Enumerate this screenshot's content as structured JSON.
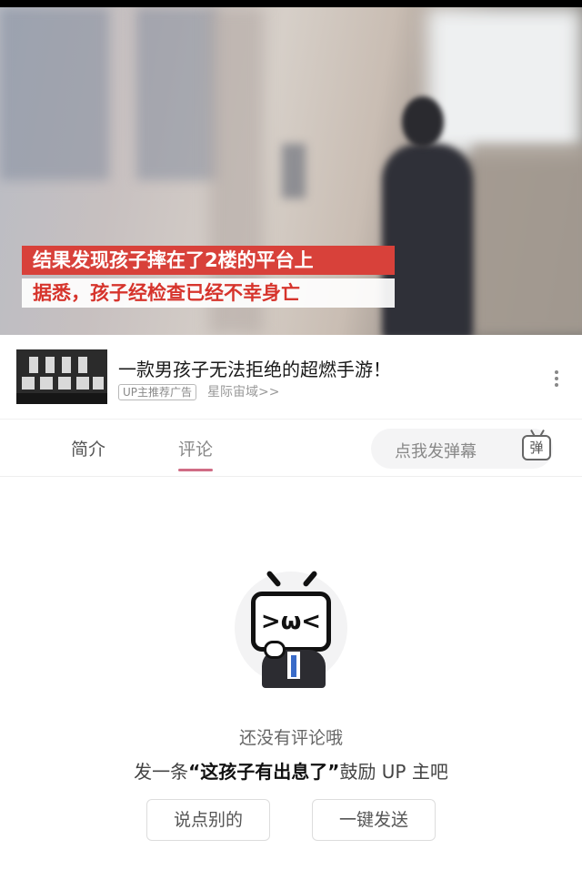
{
  "video": {
    "caption_line1": "结果发现孩子摔在了2楼的平台上",
    "caption_line2": "据悉，孩子经检查已经不幸身亡"
  },
  "ad": {
    "title": "一款男孩子无法拒绝的超燃手游！",
    "badge": "UP主推荐广告",
    "link": "星际宙域>>",
    "more_icon": "more-vertical-icon"
  },
  "tabs": {
    "intro": "简介",
    "comment": "评论",
    "active": "评论",
    "danmaku_placeholder": "点我发弹幕",
    "danmaku_icon_label": "弹",
    "accent_color": "#d06c85"
  },
  "empty_state": {
    "mascot_icon": "tv-mascot-icon",
    "line1": "还没有评论哦",
    "line2_prefix": "发一条",
    "line2_quote": "“这孩子有出息了”",
    "line2_suffix": "鼓励 UP 主吧"
  },
  "buttons": {
    "other": "说点别的",
    "send": "一键发送"
  }
}
